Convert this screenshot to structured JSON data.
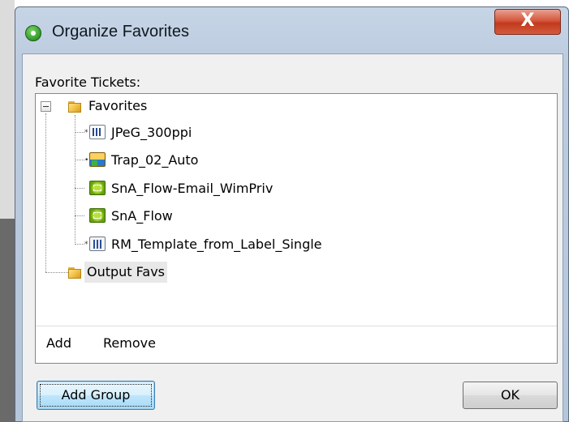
{
  "window": {
    "title": "Organize Favorites",
    "close_label": "X"
  },
  "tree": {
    "label": "Favorite Tickets:",
    "root": {
      "label": "Favorites",
      "expanded": true,
      "children": [
        {
          "label": "JPeG_300ppi",
          "icon": "jpeg-ticket-icon"
        },
        {
          "label": "Trap_02_Auto",
          "icon": "trap-ticket-icon"
        },
        {
          "label": "SnA_Flow-Email_WimPriv",
          "icon": "sna-flow-icon"
        },
        {
          "label": "SnA_Flow",
          "icon": "sna-flow-icon"
        },
        {
          "label": "RM_Template_from_Label_Single",
          "icon": "rm-template-icon"
        }
      ]
    },
    "second_group": {
      "label": "Output Favs"
    },
    "add_label": "Add",
    "remove_label": "Remove"
  },
  "buttons": {
    "add_group": "Add Group",
    "ok": "OK"
  }
}
